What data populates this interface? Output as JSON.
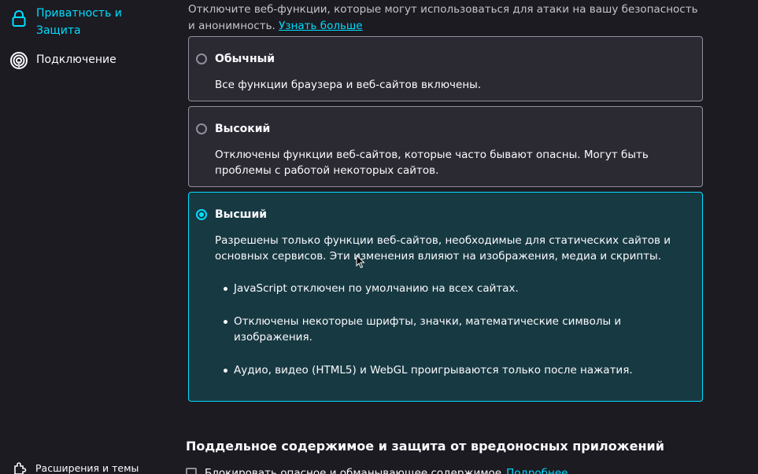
{
  "sidebar": {
    "items": [
      {
        "label": "Приватность и Защита",
        "icon": "lock-icon",
        "active": true
      },
      {
        "label": "Подключение",
        "icon": "connection-icon",
        "active": false
      }
    ],
    "footer_item": {
      "label": "Расширения и темы",
      "icon": "puzzle-piece-icon"
    }
  },
  "security": {
    "intro_text": "Отключите веб-функции, которые могут использоваться для атаки на вашу безопасность и анонимность.",
    "learn_more": "Узнать больше",
    "levels": [
      {
        "title": "Обычный",
        "description": "Все функции браузера и веб-сайтов включены.",
        "selected": false
      },
      {
        "title": "Высокий",
        "description": "Отключены функции веб-сайтов, которые часто бывают опасны. Могут быть проблемы с работой некоторых сайтов.",
        "selected": false
      },
      {
        "title": "Высший",
        "description": "Разрешены только функции веб-сайтов, необходимые для статических сайтов и основных сервисов. Эти изменения влияют на изображения, медиа и скрипты.",
        "selected": true,
        "bullets": [
          "JavaScript отключен по умолчанию на всех сайтах.",
          "Отключены некоторые шрифты, значки, математические символы и изображения.",
          "Аудио, видео (HTML5) и WebGL проигрываются только после нажатия."
        ]
      }
    ]
  },
  "deceptive": {
    "section_title": "Поддельное содержимое и защита от вредоносных приложений",
    "checkbox_label": "Блокировать опасное и обманывающее содержимое",
    "checkbox_checked": false,
    "link": "Подробнее"
  },
  "colors": {
    "accent": "#00ddff",
    "background": "#1c1b22",
    "card": "#2b2a33",
    "selected_card": "#173942"
  }
}
